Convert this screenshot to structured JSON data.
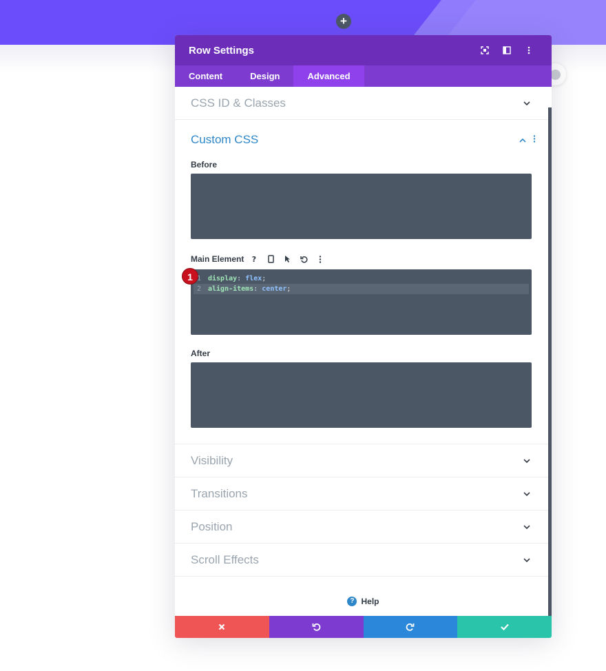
{
  "modal": {
    "title": "Row Settings",
    "tabs": [
      {
        "label": "Content",
        "active": false
      },
      {
        "label": "Design",
        "active": false
      },
      {
        "label": "Advanced",
        "active": true
      }
    ]
  },
  "sections": {
    "css_id": "CSS ID & Classes",
    "custom_css": {
      "title": "Custom CSS",
      "before_label": "Before",
      "main_label": "Main Element",
      "after_label": "After",
      "code": [
        {
          "line": "1",
          "prop": "display",
          "value": "flex"
        },
        {
          "line": "2",
          "prop": "align-items",
          "value": "center"
        }
      ]
    },
    "collapsed": [
      "Visibility",
      "Transitions",
      "Position",
      "Scroll Effects"
    ]
  },
  "badge": "1",
  "help_label": "Help",
  "icons": {
    "add": "plus-icon",
    "cancel": "close-icon",
    "undo": "undo-icon",
    "redo": "redo-icon",
    "save": "check-icon"
  },
  "colors": {
    "header": "#6c2eb9",
    "tabs": "#7d3bcf",
    "accent": "#2e87c8",
    "cancel": "#ef5555",
    "undo": "#7d3bcf",
    "redo": "#2b87da",
    "save": "#29c4a9"
  }
}
